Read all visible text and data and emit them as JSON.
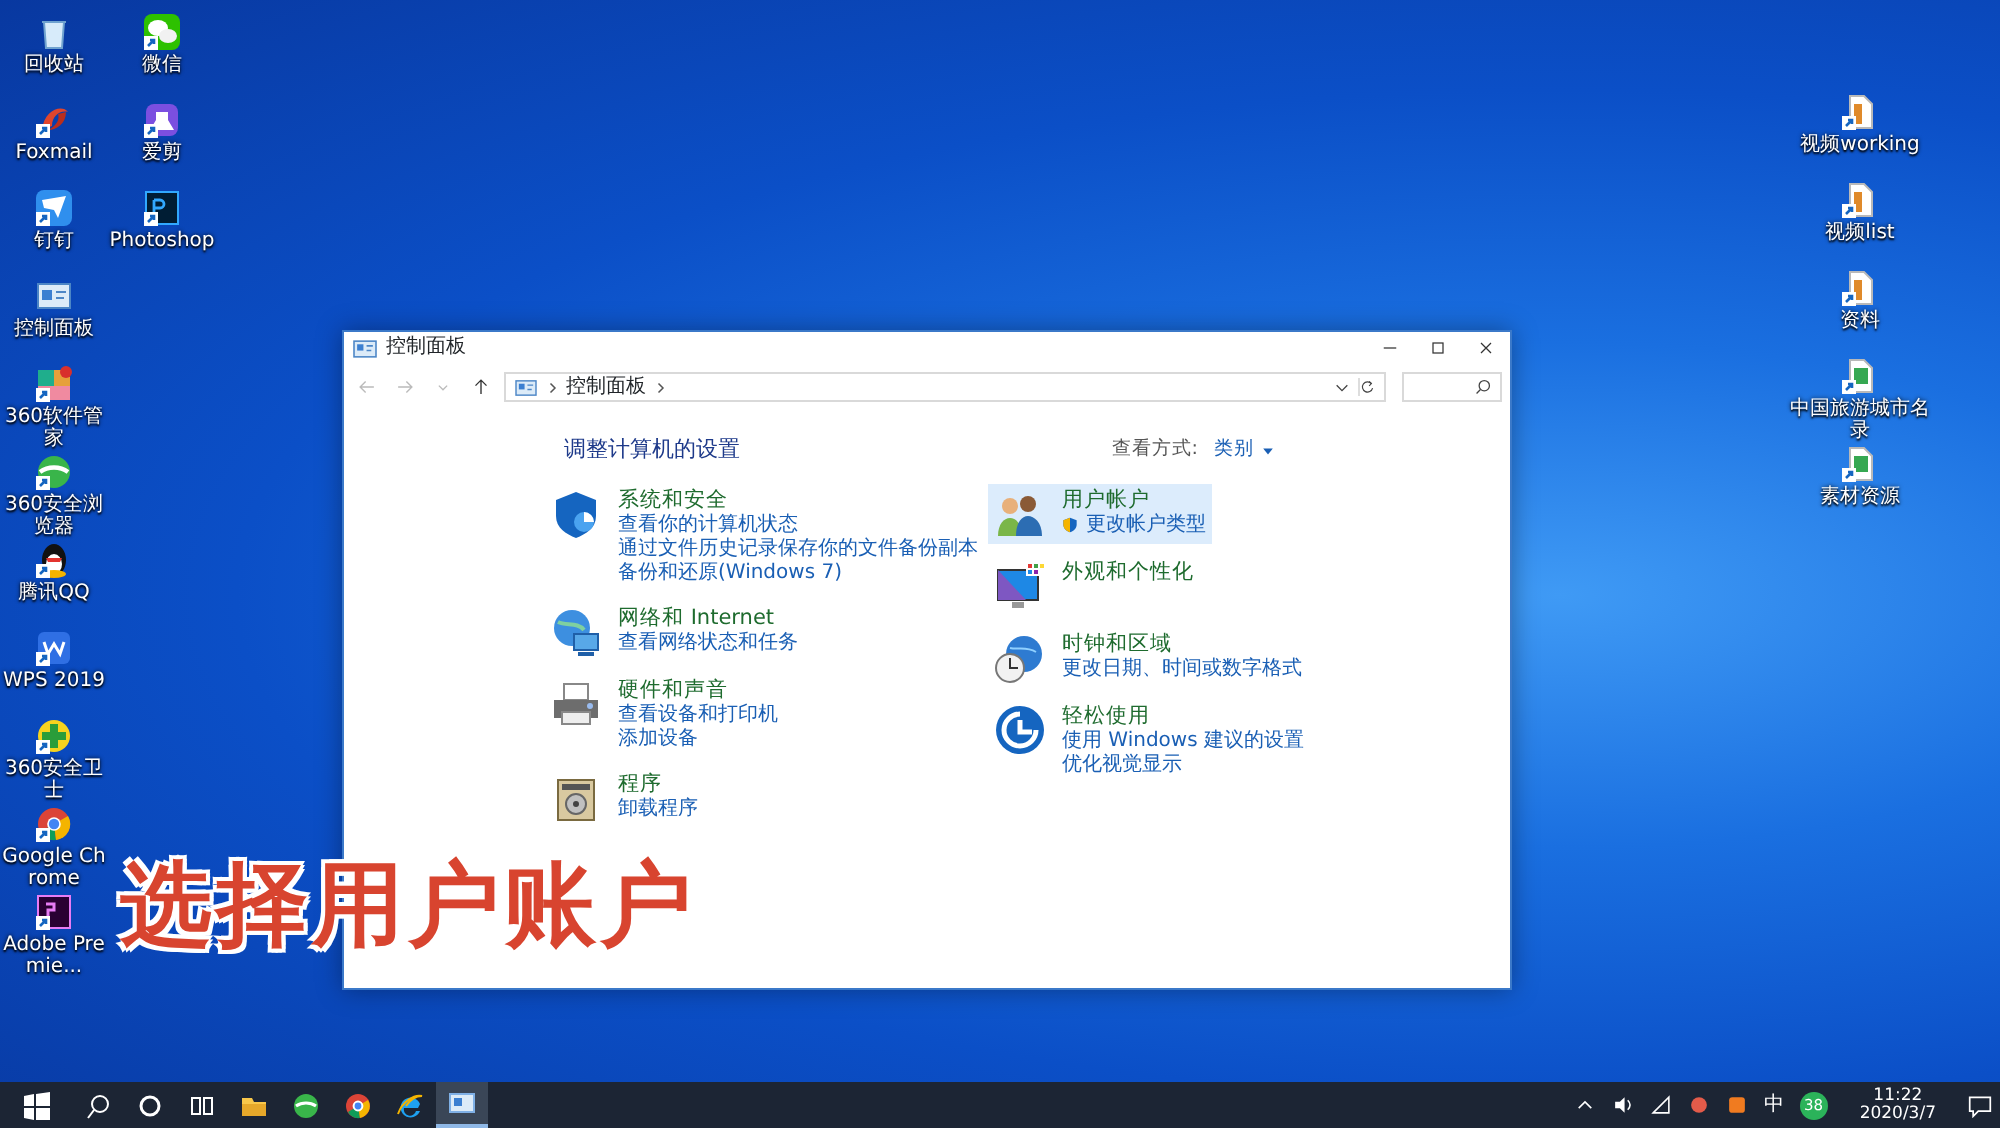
{
  "desktop": {
    "left_icons": [
      {
        "label": "回收站",
        "kind": "recycle"
      },
      {
        "label": "Foxmail",
        "kind": "foxmail"
      },
      {
        "label": "钉钉",
        "kind": "dingtalk"
      },
      {
        "label": "控制面板",
        "kind": "controlpanel"
      },
      {
        "label": "360软件管家",
        "kind": "softmgr"
      },
      {
        "label": "360安全浏览器",
        "kind": "browser360"
      },
      {
        "label": "腾讯QQ",
        "kind": "qq"
      },
      {
        "label": "WPS 2019",
        "kind": "wps"
      },
      {
        "label": "360安全卫士",
        "kind": "guard360"
      },
      {
        "label": "Google Chrome",
        "kind": "chrome"
      },
      {
        "label": "Adobe Premie...",
        "kind": "premiere"
      },
      {
        "label": "微信",
        "kind": "wechat"
      },
      {
        "label": "爱剪",
        "kind": "app"
      },
      {
        "label": "Photoshop",
        "kind": "photoshop"
      }
    ],
    "right_icons": [
      {
        "label": "视频working",
        "kind": "file"
      },
      {
        "label": "视频list",
        "kind": "file"
      },
      {
        "label": "资料",
        "kind": "file"
      },
      {
        "label": "中国旅游城市名录",
        "kind": "sheet"
      },
      {
        "label": "素材资源",
        "kind": "sheet"
      }
    ]
  },
  "window": {
    "title": "控制面板",
    "address": {
      "path": [
        "控制面板"
      ]
    },
    "heading": "调整计算机的设置",
    "view_by": {
      "label": "查看方式:",
      "value": "类别"
    },
    "left_categories": [
      {
        "kind": "security",
        "title": "系统和安全",
        "selected": false,
        "links": [
          "查看你的计算机状态",
          "通过文件历史记录保存你的文件备份副本",
          "备份和还原(Windows 7)"
        ]
      },
      {
        "kind": "network",
        "title": "网络和 Internet",
        "selected": false,
        "links": [
          "查看网络状态和任务"
        ]
      },
      {
        "kind": "hardware",
        "title": "硬件和声音",
        "selected": false,
        "links": [
          "查看设备和打印机",
          "添加设备"
        ]
      },
      {
        "kind": "programs",
        "title": "程序",
        "selected": false,
        "links": [
          "卸载程序"
        ]
      }
    ],
    "right_categories": [
      {
        "kind": "users",
        "title": "用户帐户",
        "selected": true,
        "links": [
          "更改帐户类型"
        ]
      },
      {
        "kind": "appearance",
        "title": "外观和个性化",
        "selected": false
      },
      {
        "kind": "clock",
        "title": "时钟和区域",
        "selected": false,
        "links": [
          "更改日期、时间或数字格式"
        ]
      },
      {
        "kind": "ease",
        "title": "轻松使用",
        "selected": false,
        "links": [
          "使用 Windows 建议的设置",
          "优化视觉显示"
        ]
      }
    ]
  },
  "caption": "选择用户账户",
  "taskbar": {
    "items": [
      {
        "kind": "start",
        "selected": false
      },
      {
        "kind": "search",
        "selected": false
      },
      {
        "kind": "cortana",
        "selected": false
      },
      {
        "kind": "taskview",
        "selected": false
      },
      {
        "kind": "explorer",
        "selected": false
      },
      {
        "kind": "browser360",
        "selected": false
      },
      {
        "kind": "chrome",
        "selected": false
      },
      {
        "kind": "ie",
        "selected": false
      },
      {
        "kind": "controlpanel",
        "selected": true
      }
    ],
    "ime": "中",
    "badge": "38",
    "time": "11:22",
    "date": "2020/3/7"
  }
}
